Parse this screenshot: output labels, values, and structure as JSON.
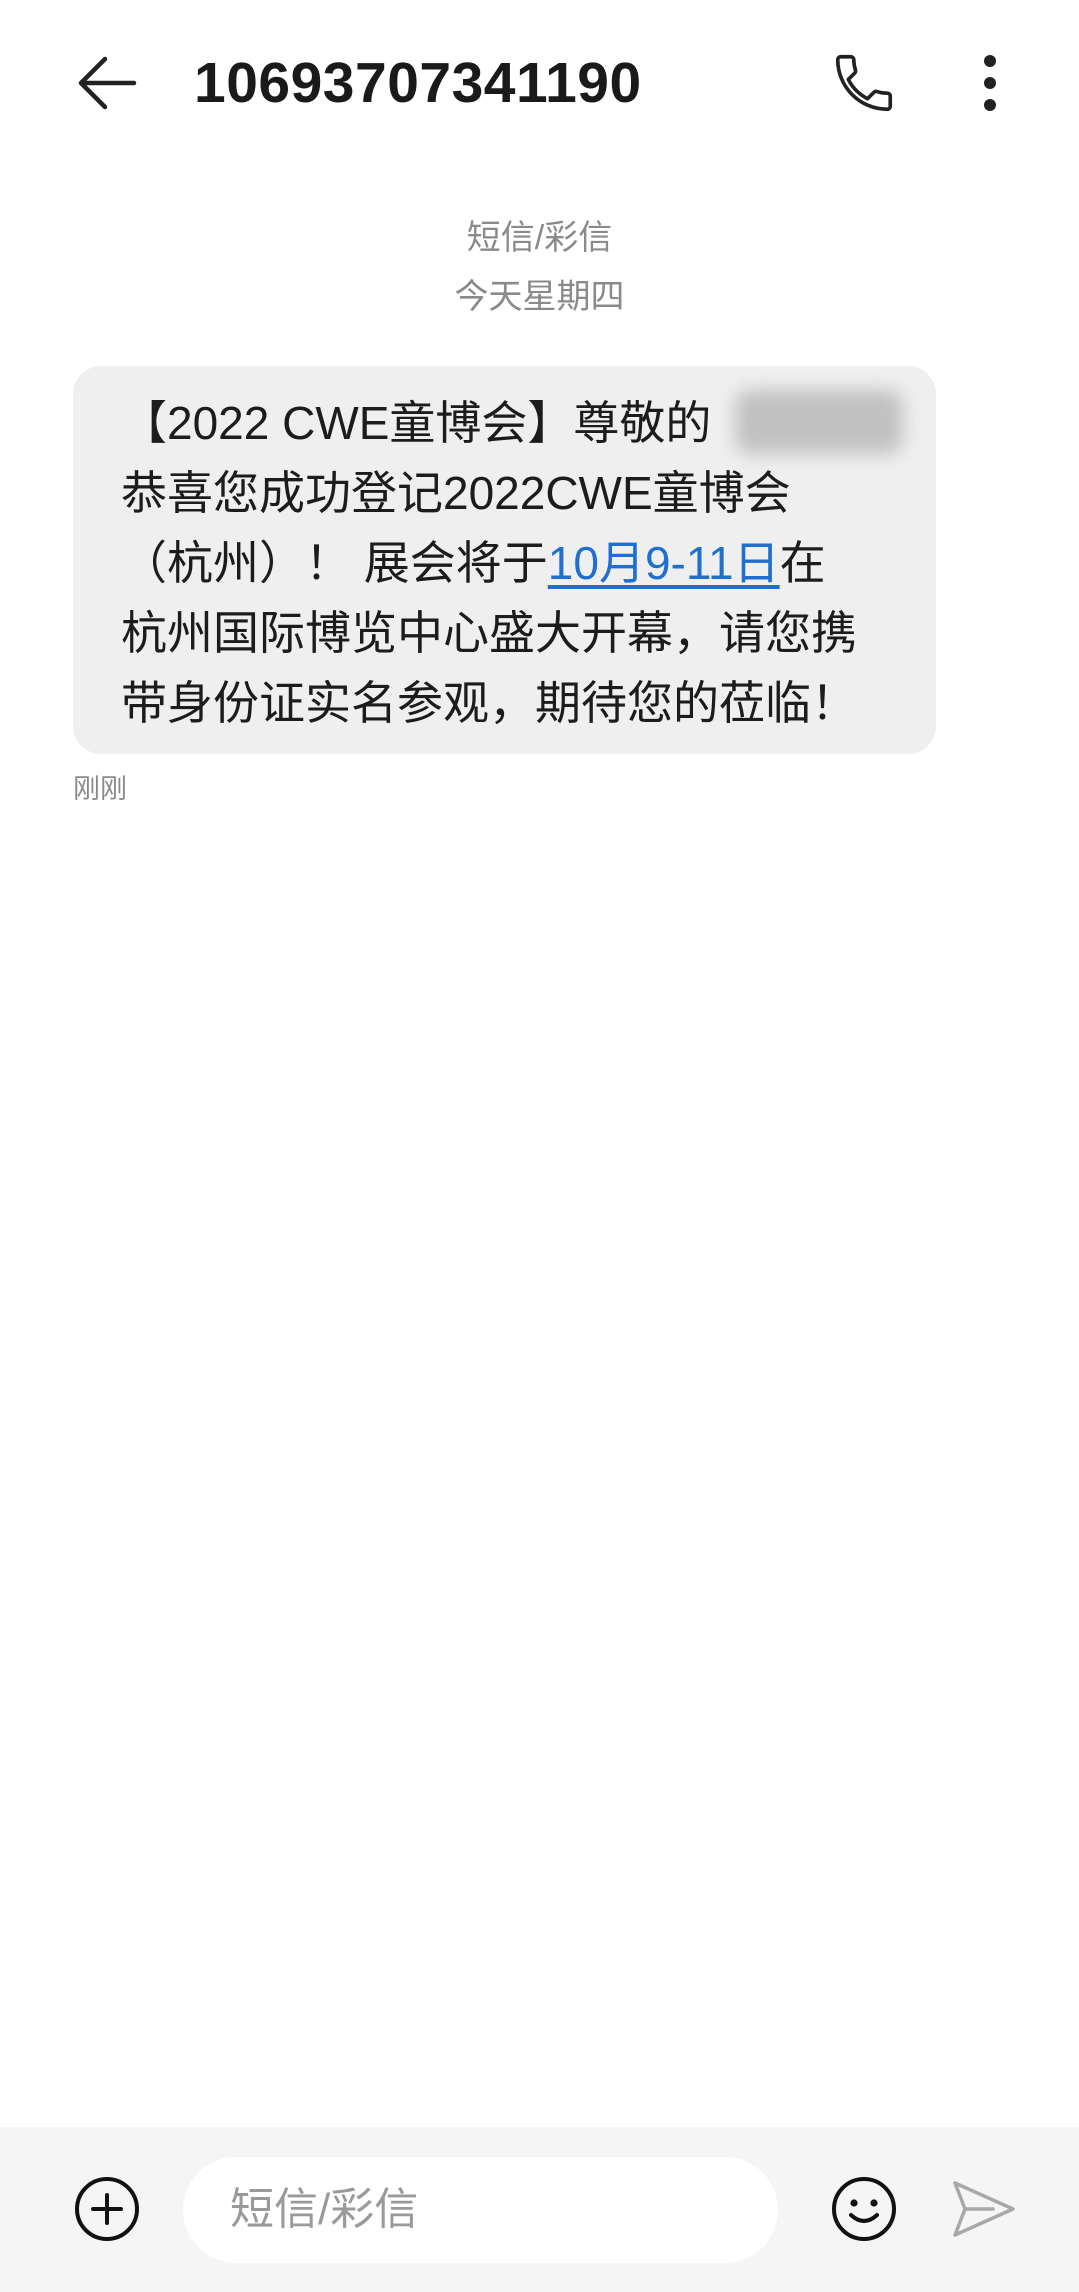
{
  "header": {
    "title": "10693707341190",
    "back_icon": "back-arrow-icon",
    "call_icon": "phone-icon",
    "menu_icon": "more-vertical-icon"
  },
  "conversation": {
    "channel_label": "短信/彩信",
    "date_label": "今天星期四"
  },
  "message": {
    "line1": "【2022 CWE童博会】尊敬的",
    "line2": "恭喜您成功登记2022CWE童博会",
    "line3_before": "（杭州）！ 展会将于",
    "line3_link": "10月9-11日",
    "line3_after": "在",
    "line4": "杭州国际博览中心盛大开幕，请您携",
    "line5": "带身份证实名参观，期待您的莅临！",
    "timestamp": "刚刚"
  },
  "composer": {
    "placeholder": "短信/彩信",
    "attach_icon": "add-circle-icon",
    "emoji_icon": "emoji-icon",
    "send_icon": "send-icon"
  },
  "colors": {
    "link": "#1f6fd1",
    "bubble": "#efefef",
    "composer_bar": "#f5f5f5",
    "muted_text": "#8a8a8a"
  }
}
